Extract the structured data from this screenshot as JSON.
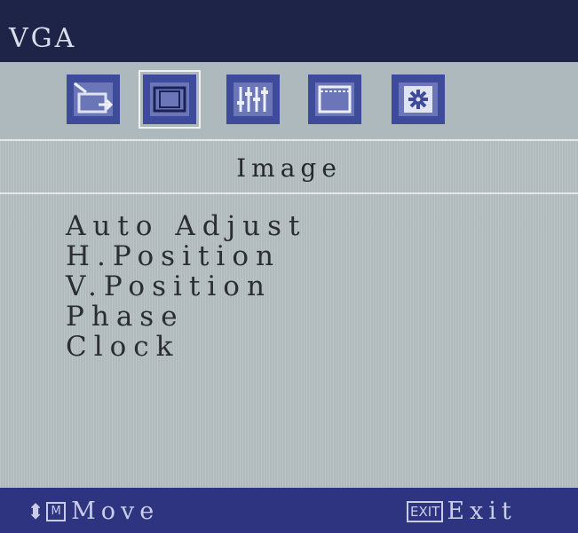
{
  "window": {
    "title": "VGA"
  },
  "tabs": [
    {
      "icon": "input-source-icon",
      "selected": false
    },
    {
      "icon": "image-window-icon",
      "selected": true
    },
    {
      "icon": "equalizer-sliders-icon",
      "selected": false
    },
    {
      "icon": "osd-screen-icon",
      "selected": false
    },
    {
      "icon": "gear-settings-icon",
      "selected": false
    }
  ],
  "section": {
    "title": "Image"
  },
  "menu": {
    "items": [
      "Auto Adjust",
      "H.Position",
      "V.Position",
      "Phase",
      "Clock"
    ]
  },
  "footer": {
    "move_glyph": "⬍",
    "move_key": "M",
    "move_label": "Move",
    "exit_key": "EXIT",
    "exit_label": "Exit"
  },
  "colors": {
    "title_bar": "#1e2448",
    "icon_tile": "#3e4a9a",
    "footer_bar": "#2e3480",
    "background": "#b8c2c3"
  }
}
